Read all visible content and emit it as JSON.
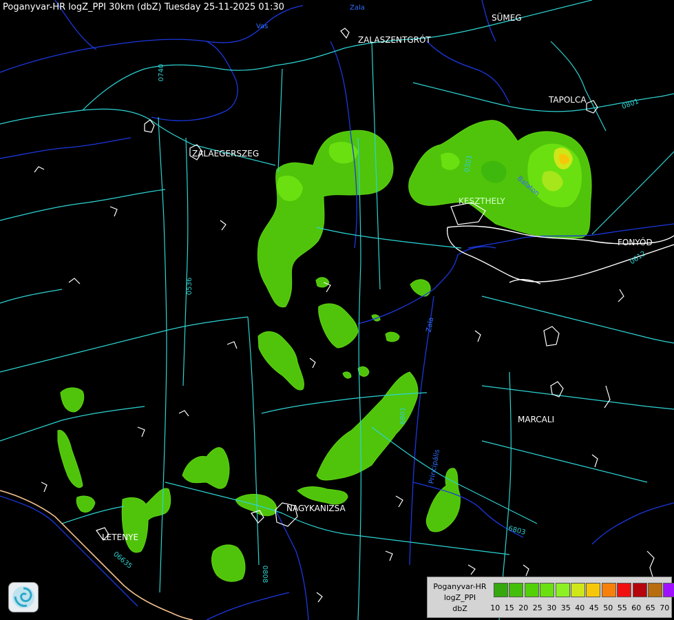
{
  "title": "Poganyvar-HR logZ_PPI 30km (dbZ) Tuesday 25-11-2025 01:30",
  "cities": [
    {
      "name": "SÜMEG"
    },
    {
      "name": "ZALASZENTGRÓT"
    },
    {
      "name": "TAPOLCA"
    },
    {
      "name": "ZALAEGERSZEG"
    },
    {
      "name": "KESZTHELY"
    },
    {
      "name": "FONYÓD"
    },
    {
      "name": "MARCALI"
    },
    {
      "name": "NAGYKANIZSA"
    },
    {
      "name": "LETENYE"
    }
  ],
  "road_labels": [
    "0740",
    "0536",
    "6801",
    "6803",
    "06635",
    "0808",
    "0801",
    "0301",
    "0612"
  ],
  "river_labels": [
    "Zala",
    "Vas",
    "Principális",
    "Balaton",
    "Zala"
  ],
  "legend": {
    "line1": "Poganyvar-HR",
    "line2": "logZ_PPI",
    "line3": "dbZ",
    "ticks": [
      "10",
      "15",
      "20",
      "25",
      "30",
      "35",
      "40",
      "45",
      "50",
      "55",
      "60",
      "65",
      "70"
    ],
    "colors": [
      "#34a80c",
      "#43be0a",
      "#52d008",
      "#6ae010",
      "#8cf023",
      "#cfe619",
      "#f6c708",
      "#f6800b",
      "#f01010",
      "#b4060c",
      "#b86d0e",
      "#a012ff",
      "#a6a9f5"
    ]
  },
  "logo": {
    "icon": "radar-logo-icon"
  }
}
